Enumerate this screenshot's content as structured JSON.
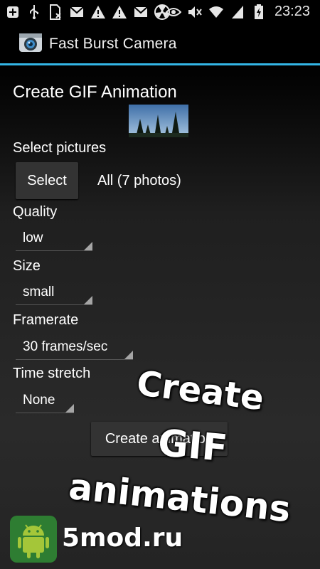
{
  "status_bar": {
    "time": "23:23",
    "icons": [
      "plus-icon",
      "usb-icon",
      "sim-card-icon",
      "gmail-icon",
      "warning-icon",
      "warning-icon",
      "gmail-icon",
      "radiation-icon",
      "eye-icon",
      "mute-icon",
      "wifi-icon",
      "signal-icon",
      "battery-charging-icon"
    ]
  },
  "app": {
    "title": "Fast Burst Camera",
    "accent": "#33b5e5"
  },
  "screen": {
    "heading": "Create GIF Animation",
    "select_pictures_label": "Select pictures",
    "select_button": "Select",
    "photos_count": "All (7 photos)",
    "quality_label": "Quality",
    "quality_value": "low",
    "size_label": "Size",
    "size_value": "small",
    "framerate_label": "Framerate",
    "framerate_value": "30 frames/sec",
    "time_stretch_label": "Time stretch",
    "time_stretch_value": "None",
    "create_button": "Create animation"
  },
  "promo": {
    "line1": "Create",
    "line2": "GIF",
    "line3": "animations"
  },
  "watermark": {
    "text": "5mod.ru"
  }
}
